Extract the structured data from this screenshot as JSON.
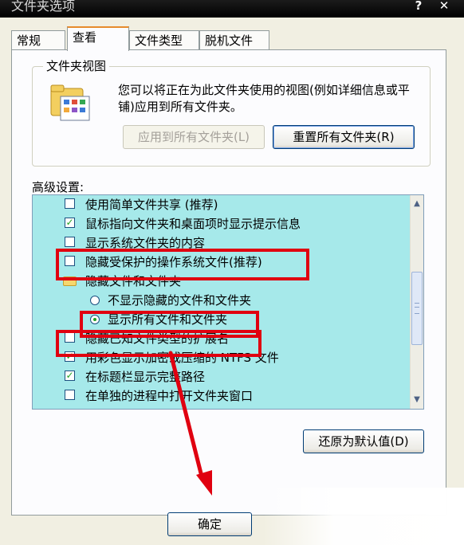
{
  "window": {
    "title": "文件夹选项",
    "help_glyph": "?",
    "close_glyph": "✕"
  },
  "tabs": [
    {
      "label": "常规"
    },
    {
      "label": "查看"
    },
    {
      "label": "文件类型"
    },
    {
      "label": "脱机文件"
    }
  ],
  "folder_views": {
    "group_title": "文件夹视图",
    "description": "您可以将正在为此文件夹使用的视图(例如详细信息或平铺)应用到所有文件夹。",
    "apply_all_button": "应用到所有文件夹(L)",
    "reset_all_button": "重置所有文件夹(R)"
  },
  "advanced": {
    "label": "高级设置:",
    "items": [
      {
        "type": "checkbox",
        "checked": false,
        "label": "使用简单文件共享 (推荐)"
      },
      {
        "type": "checkbox",
        "checked": true,
        "label": "鼠标指向文件夹和桌面项时显示提示信息"
      },
      {
        "type": "checkbox",
        "checked": false,
        "label": "显示系统文件夹的内容"
      },
      {
        "type": "checkbox",
        "checked": false,
        "label": "隐藏受保护的操作系统文件(推荐)"
      },
      {
        "type": "folder",
        "label": "隐藏文件和文件夹"
      },
      {
        "type": "radio",
        "checked": false,
        "label": "不显示隐藏的文件和文件夹"
      },
      {
        "type": "radio",
        "checked": true,
        "label": "显示所有文件和文件夹"
      },
      {
        "type": "checkbox",
        "checked": false,
        "label": "隐藏已知文件类型的扩展名"
      },
      {
        "type": "checkbox",
        "checked": true,
        "label": "用彩色显示加密或压缩的 NTFS 文件"
      },
      {
        "type": "checkbox",
        "checked": true,
        "label": "在标题栏显示完整路径"
      },
      {
        "type": "checkbox",
        "checked": false,
        "label": "在单独的进程中打开文件夹窗口"
      }
    ],
    "restore_defaults_button": "还原为默认值(D)"
  },
  "ok_button": "确定",
  "colors": {
    "list_background": "#a6e9ea",
    "annotation_red": "#e00010",
    "check_green": "#21a121"
  }
}
